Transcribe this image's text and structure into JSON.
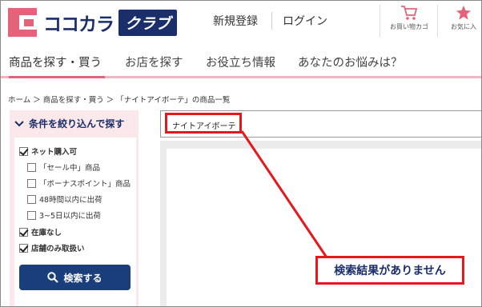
{
  "brand": {
    "logo_text": "ココカラ",
    "logo_badge": "クラブ",
    "accent": "#e4637a",
    "navy": "#1a2e6b"
  },
  "header": {
    "signup": "新規登録",
    "login": "ログイン",
    "cart": "お買い物カゴ",
    "favorites": "お気に入"
  },
  "nav": {
    "items": [
      "商品を探す・買う",
      "お店を探す",
      "お役立ち情報",
      "あなたのお悩みは？"
    ]
  },
  "breadcrumb": "ホーム ＞ 商品を探す・買う ＞ 「ナイトアイボーテ」の商品一覧",
  "sidebar": {
    "title": "条件を絞り込んで探す",
    "filters": [
      {
        "label": "ネット購入可",
        "checked": true,
        "bold": true
      },
      {
        "label": "「セール中」商品",
        "checked": false,
        "bold": false
      },
      {
        "label": "「ボーナスポイント」商品",
        "checked": false,
        "bold": false
      },
      {
        "label": "48時間以内に出荷",
        "checked": false,
        "bold": false
      },
      {
        "label": "3~5日以内に出荷",
        "checked": false,
        "bold": false
      },
      {
        "label": "在庫なし",
        "checked": true,
        "bold": true
      },
      {
        "label": "店舗のみ取扱い",
        "checked": true,
        "bold": true
      }
    ],
    "search_button": "検索する"
  },
  "search": {
    "value": "ナイトアイボーテ"
  },
  "annotation": {
    "callout": "検索結果がありません",
    "color": "#e5171f"
  }
}
